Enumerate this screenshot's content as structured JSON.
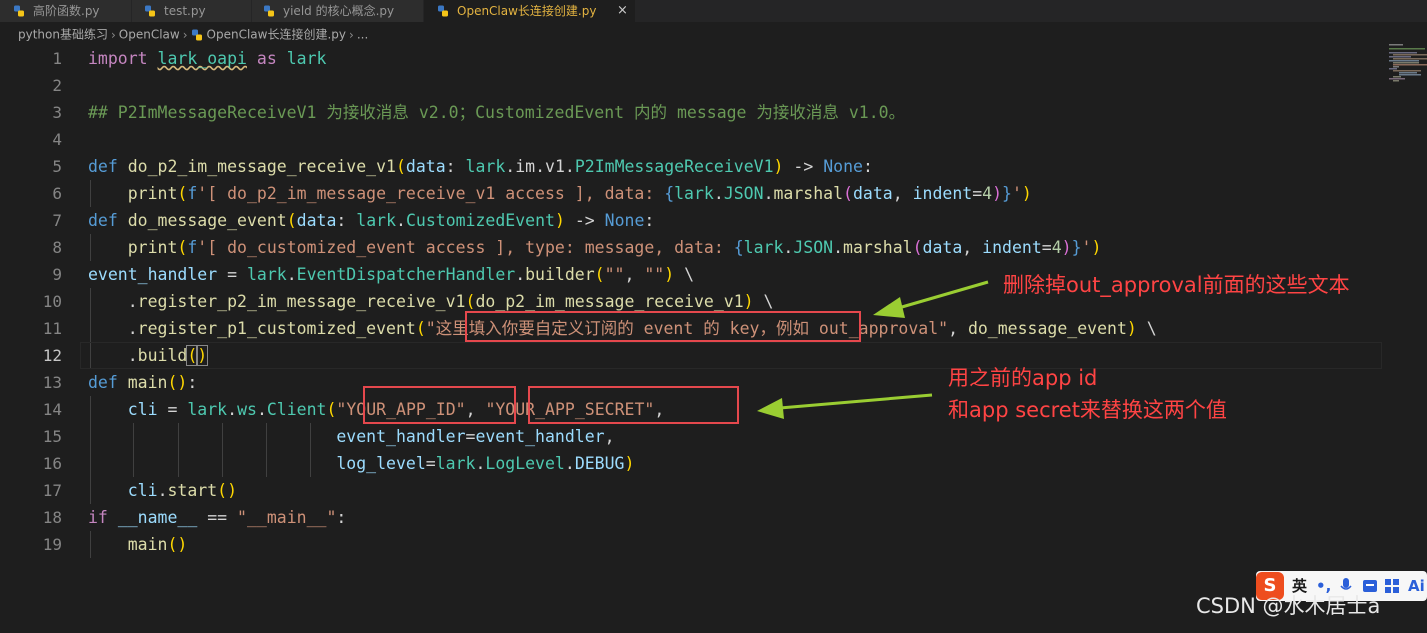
{
  "tabs": [
    {
      "label": "高阶函数.py",
      "active": false
    },
    {
      "label": "test.py",
      "active": false
    },
    {
      "label": "yield 的核心概念.py",
      "active": false
    },
    {
      "label": "OpenClaw长连接创建.py",
      "active": true
    }
  ],
  "tab_close_glyph": "×",
  "breadcrumb": {
    "folder": "python基础练习",
    "subfolder": "OpenClaw",
    "file": "OpenClaw长连接创建.py",
    "ellipsis": "..."
  },
  "line_numbers": [
    "1",
    "2",
    "3",
    "4",
    "5",
    "6",
    "7",
    "8",
    "9",
    "10",
    "11",
    "12",
    "13",
    "14",
    "15",
    "16",
    "17",
    "18",
    "19"
  ],
  "current_line": "12",
  "code": {
    "l1_import": "import",
    "l1_module": "lark_oapi",
    "l1_as": "as",
    "l1_alias": "lark",
    "l3_comment": "## P2ImMessageReceiveV1 为接收消息 v2.0；CustomizedEvent 内的 message 为接收消息 v1.0。",
    "l5_def": "def",
    "l5_fn": "do_p2_im_message_receive_v1",
    "l5_param": "data",
    "l5_type_mod": "lark",
    "l5_type_rest": "im.v1.",
    "l5_type_cls": "P2ImMessageReceiveV1",
    "l5_ret": "None",
    "l6_print": "print",
    "l6_f": "f",
    "l6_str": "'[ do_p2_im_message_receive_v1 access ], data: ",
    "l6_lark": "lark",
    "l6_json": "JSON",
    "l6_marshal": "marshal",
    "l6_data": "data",
    "l6_indent": "indent",
    "l6_num": "4",
    "l6_end": "'",
    "l7_def": "def",
    "l7_fn": "do_message_event",
    "l7_param": "data",
    "l7_type_mod": "lark",
    "l7_type_cls": "CustomizedEvent",
    "l7_ret": "None",
    "l8_print": "print",
    "l8_f": "f",
    "l8_str": "'[ do_customized_event access ], type: message, data: ",
    "l8_lark": "lark",
    "l8_json": "JSON",
    "l8_marshal": "marshal",
    "l8_data": "data",
    "l8_indent": "indent",
    "l8_num": "4",
    "l8_end": "'",
    "l9_var": "event_handler",
    "l9_lark": "lark",
    "l9_cls": "EventDispatcherHandler",
    "l9_method": "builder",
    "l9_s1": "\"\"",
    "l9_s2": "\"\"",
    "l10_method": "register_p2_im_message_receive_v1",
    "l10_arg": "do_p2_im_message_receive_v1",
    "l11_method": "register_p1_customized_event",
    "l11_str_a": "\"这里填入你要自定义订阅的 event 的 key",
    "l11_str_b": "，例如 out_approval\"",
    "l11_arg": "do_message_event",
    "l12_method": "build",
    "l13_def": "def",
    "l13_fn": "main",
    "l14_var": "cli",
    "l14_lark": "lark",
    "l14_ws": "ws",
    "l14_cls": "Client",
    "l14_s1": "\"YOUR_APP_ID\"",
    "l14_s2": "\"YOUR_APP_SECRET\"",
    "l15_kw": "event_handler",
    "l15_val": "event_handler",
    "l16_kw": "log_level",
    "l16_lark": "lark",
    "l16_cls": "LogLevel",
    "l16_attr": "DEBUG",
    "l17_var": "cli",
    "l17_method": "start",
    "l18_if": "if",
    "l18_name": "__name__",
    "l18_str": "\"__main__\"",
    "l19_fn": "main"
  },
  "annotations": {
    "delete_note": "删除掉out_approval前面的这些文本",
    "replace_note_line1": "用之前的app id",
    "replace_note_line2": "和app secret来替换这两个值"
  },
  "ime": {
    "logo": "S",
    "mode": "英"
  },
  "watermark": "CSDN @水木居士a",
  "colors": {
    "keyword": "#569cd6",
    "function": "#dcdcaa",
    "string": "#ce9178",
    "comment": "#6a9955",
    "class": "#4ec9b0",
    "param": "#9cdcfe",
    "annotation_red": "#e5484d",
    "arrow_green": "#9acd32"
  }
}
